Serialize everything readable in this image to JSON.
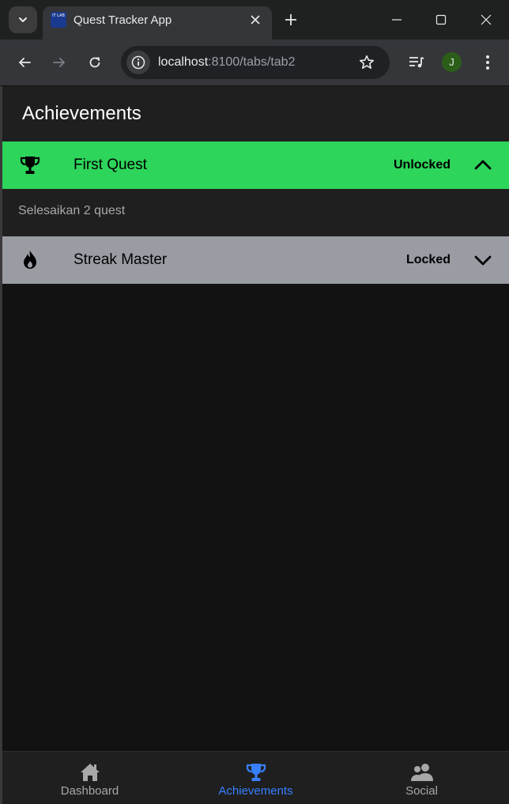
{
  "browser": {
    "tab_title": "Quest Tracker App",
    "favicon_text": "IT LAB",
    "url_host": "localhost",
    "url_path": ":8100/tabs/tab2",
    "profile_initial": "J"
  },
  "header": {
    "title": "Achievements"
  },
  "achievements": [
    {
      "name": "First Quest",
      "status": "Unlocked",
      "icon": "trophy-icon",
      "description": "Selesaikan 2 quest",
      "expanded": true,
      "color": "#2dd55b"
    },
    {
      "name": "Streak Master",
      "status": "Locked",
      "icon": "flame-icon",
      "expanded": false,
      "color": "#9a9ca3"
    }
  ],
  "tabbar": {
    "items": [
      {
        "label": "Dashboard",
        "icon": "home-icon",
        "active": false
      },
      {
        "label": "Achievements",
        "icon": "trophy-icon",
        "active": true
      },
      {
        "label": "Social",
        "icon": "people-icon",
        "active": false
      }
    ],
    "active_color": "#3880ff"
  }
}
